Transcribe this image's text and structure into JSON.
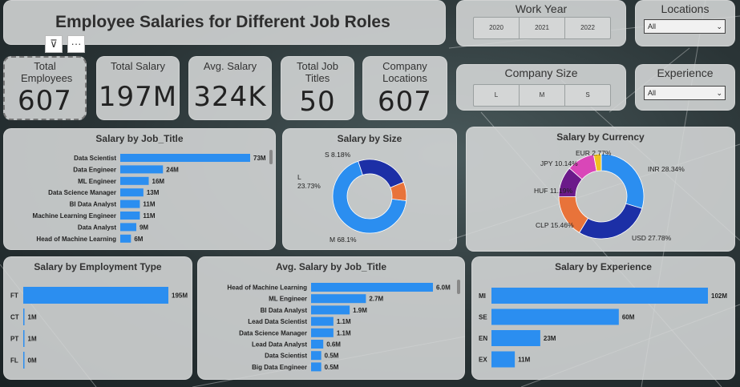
{
  "page": {
    "title": "Employee Salaries for Different Job Roles"
  },
  "toolbar": {
    "filter_icon": "filter-icon",
    "more_icon": "more-options-icon",
    "more_label": "···",
    "filter_glyph": "⊽"
  },
  "kpis": [
    {
      "label": "Total Employees",
      "value": "607"
    },
    {
      "label": "Total Salary",
      "value": "197M"
    },
    {
      "label": "Avg. Salary",
      "value": "324K"
    },
    {
      "label": "Total Job Titles",
      "value": "50"
    },
    {
      "label": "Company Locations",
      "value": "607"
    }
  ],
  "slicers": {
    "work_year": {
      "caption": "Work Year",
      "options": [
        "2020",
        "2021",
        "2022"
      ]
    },
    "company_size": {
      "caption": "Company Size",
      "options": [
        "L",
        "M",
        "S"
      ]
    },
    "locations": {
      "caption": "Locations",
      "selected": "All"
    },
    "experience": {
      "caption": "Experience",
      "selected": "All"
    }
  },
  "colors": {
    "bar": "#2b8ef0",
    "size_L": "#1c2fa6",
    "size_M": "#2b8ef0",
    "size_S": "#e8733a"
  },
  "chart_data": [
    {
      "type": "bar",
      "title": "Salary by Job_Title",
      "orientation": "horizontal",
      "categories": [
        "Data Scientist",
        "Data Engineer",
        "ML Engineer",
        "Data Science Manager",
        "BI Data Analyst",
        "Machine Learning Engineer",
        "Data Analyst",
        "Head of Machine Learning"
      ],
      "values": [
        73,
        24,
        16,
        13,
        11,
        11,
        9,
        6
      ],
      "labels": [
        "73M",
        "24M",
        "16M",
        "13M",
        "11M",
        "11M",
        "9M",
        "6M"
      ]
    },
    {
      "type": "pie",
      "title": "Salary by Size",
      "donut": true,
      "categories": [
        "M",
        "L",
        "S"
      ],
      "values": [
        68.1,
        23.73,
        8.18
      ],
      "labels": [
        "M 68.1%",
        "L 23.73%",
        "S 8.18%"
      ]
    },
    {
      "type": "pie",
      "title": "Salary by Currency",
      "donut": true,
      "categories": [
        "INR",
        "USD",
        "CLP",
        "HUF",
        "JPY",
        "EUR"
      ],
      "values": [
        28.34,
        27.78,
        15.46,
        11.19,
        10.14,
        2.77
      ],
      "labels": [
        "INR 28.34%",
        "USD 27.78%",
        "CLP 15.46%",
        "HUF 11.19%",
        "JPY 10.14%",
        "EUR 2.77%"
      ],
      "colors": [
        "#2b8ef0",
        "#1c2fa6",
        "#e8733a",
        "#6b1a8a",
        "#d946b8",
        "#f0c020"
      ]
    },
    {
      "type": "bar",
      "title": "Salary by Employment Type",
      "orientation": "horizontal",
      "categories": [
        "FT",
        "CT",
        "PT",
        "FL"
      ],
      "values": [
        195,
        1,
        1,
        0
      ],
      "labels": [
        "195M",
        "1M",
        "1M",
        "0M"
      ]
    },
    {
      "type": "bar",
      "title": "Avg. Salary by Job_Title",
      "orientation": "horizontal",
      "categories": [
        "Head of Machine Learning",
        "ML Engineer",
        "BI Data Analyst",
        "Lead Data Scientist",
        "Data Science Manager",
        "Lead Data Analyst",
        "Data Scientist",
        "Big Data Engineer"
      ],
      "values": [
        6.0,
        2.7,
        1.9,
        1.1,
        1.1,
        0.6,
        0.5,
        0.5
      ],
      "labels": [
        "6.0M",
        "2.7M",
        "1.9M",
        "1.1M",
        "1.1M",
        "0.6M",
        "0.5M",
        "0.5M"
      ]
    },
    {
      "type": "bar",
      "title": "Salary by Experience",
      "orientation": "horizontal",
      "categories": [
        "MI",
        "SE",
        "EN",
        "EX"
      ],
      "values": [
        102,
        60,
        23,
        11
      ],
      "labels": [
        "102M",
        "60M",
        "23M",
        "11M"
      ]
    }
  ]
}
